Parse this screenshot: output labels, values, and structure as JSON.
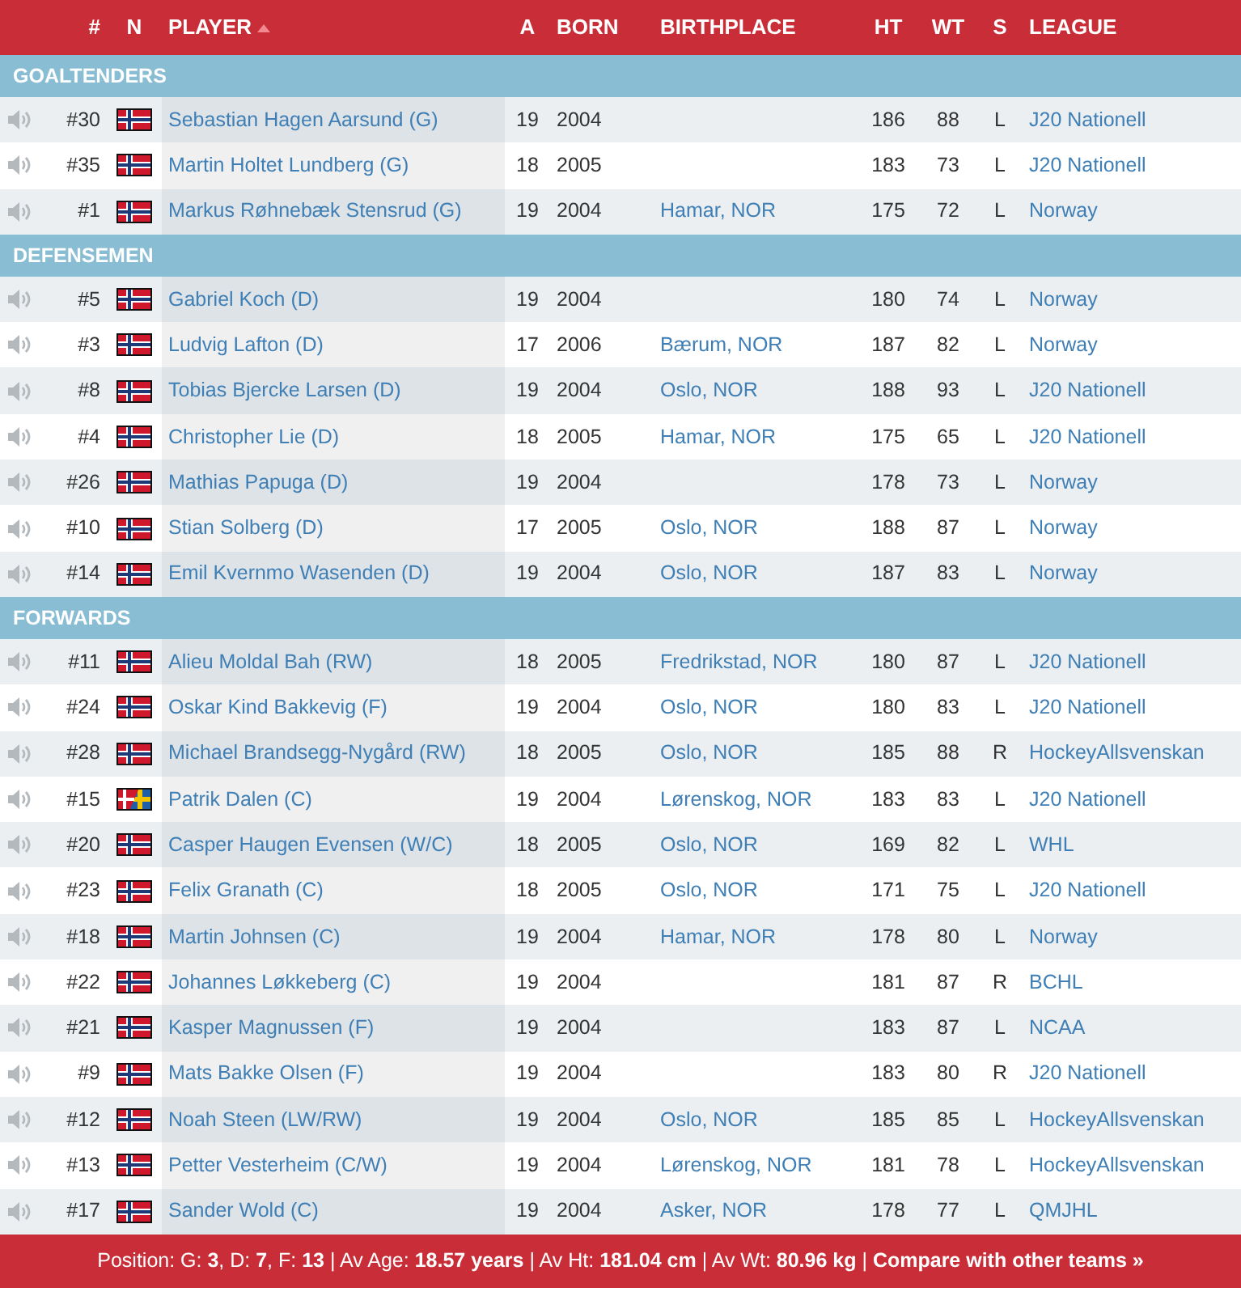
{
  "columns": [
    {
      "sorted": false
    },
    {
      "label": "#",
      "sorted": false
    },
    {
      "label": "N",
      "sorted": false
    },
    {
      "label": "PLAYER",
      "sorted": true
    },
    {
      "label": "A",
      "sorted": false
    },
    {
      "label": "BORN",
      "sorted": false
    },
    {
      "label": "BIRTHPLACE",
      "sorted": false
    },
    {
      "label": "HT",
      "sorted": false
    },
    {
      "label": "WT",
      "sorted": false
    },
    {
      "label": "S",
      "sorted": false
    },
    {
      "label": "LEAGUE",
      "sorted": false
    }
  ],
  "groups": [
    {
      "title": "GOALTENDERS",
      "players": [
        {
          "number": "#30",
          "dual_nationality": false,
          "name": "Sebastian Hagen Aarsund (G)",
          "age": "19",
          "born": "2004",
          "ht": "186",
          "wt": "88",
          "shoots": "L",
          "league": "J20 Nationell"
        },
        {
          "number": "#35",
          "dual_nationality": false,
          "name": "Martin Holtet Lundberg (G)",
          "age": "18",
          "born": "2005",
          "ht": "183",
          "wt": "73",
          "shoots": "L",
          "league": "J20 Nationell"
        },
        {
          "number": "#1",
          "dual_nationality": false,
          "name": "Markus Røhnebæk Stensrud (G)",
          "age": "19",
          "born": "2004",
          "birthplace": "Hamar, NOR",
          "ht": "175",
          "wt": "72",
          "shoots": "L",
          "league": "Norway"
        }
      ]
    },
    {
      "title": "DEFENSEMEN",
      "players": [
        {
          "number": "#5",
          "dual_nationality": false,
          "name": "Gabriel Koch (D)",
          "age": "19",
          "born": "2004",
          "ht": "180",
          "wt": "74",
          "shoots": "L",
          "league": "Norway"
        },
        {
          "number": "#3",
          "dual_nationality": false,
          "name": "Ludvig Lafton (D)",
          "age": "17",
          "born": "2006",
          "birthplace": "Bærum, NOR",
          "ht": "187",
          "wt": "82",
          "shoots": "L",
          "league": "Norway"
        },
        {
          "number": "#8",
          "dual_nationality": false,
          "name": "Tobias Bjercke Larsen (D)",
          "age": "19",
          "born": "2004",
          "birthplace": "Oslo, NOR",
          "ht": "188",
          "wt": "93",
          "shoots": "L",
          "league": "J20 Nationell"
        },
        {
          "number": "#4",
          "dual_nationality": false,
          "name": "Christopher Lie (D)",
          "age": "18",
          "born": "2005",
          "birthplace": "Hamar, NOR",
          "ht": "175",
          "wt": "65",
          "shoots": "L",
          "league": "J20 Nationell"
        },
        {
          "number": "#26",
          "dual_nationality": false,
          "name": "Mathias Papuga (D)",
          "age": "19",
          "born": "2004",
          "ht": "178",
          "wt": "73",
          "shoots": "L",
          "league": "Norway"
        },
        {
          "number": "#10",
          "dual_nationality": false,
          "name": "Stian Solberg (D)",
          "age": "17",
          "born": "2005",
          "birthplace": "Oslo, NOR",
          "ht": "188",
          "wt": "87",
          "shoots": "L",
          "league": "Norway"
        },
        {
          "number": "#14",
          "dual_nationality": false,
          "name": "Emil Kvernmo Wasenden (D)",
          "age": "19",
          "born": "2004",
          "birthplace": "Oslo, NOR",
          "ht": "187",
          "wt": "83",
          "shoots": "L",
          "league": "Norway"
        }
      ]
    },
    {
      "title": "FORWARDS",
      "players": [
        {
          "number": "#11",
          "dual_nationality": false,
          "name": "Alieu Moldal Bah (RW)",
          "age": "18",
          "born": "2005",
          "birthplace": "Fredrikstad, NOR",
          "ht": "180",
          "wt": "87",
          "shoots": "L",
          "league": "J20 Nationell"
        },
        {
          "number": "#24",
          "dual_nationality": false,
          "name": "Oskar Kind Bakkevig (F)",
          "age": "19",
          "born": "2004",
          "birthplace": "Oslo, NOR",
          "ht": "180",
          "wt": "83",
          "shoots": "L",
          "league": "J20 Nationell"
        },
        {
          "number": "#28",
          "dual_nationality": false,
          "name": "Michael Brandsegg-Nygård (RW)",
          "age": "18",
          "born": "2005",
          "birthplace": "Oslo, NOR",
          "ht": "185",
          "wt": "88",
          "shoots": "R",
          "league": "HockeyAllsvenskan"
        },
        {
          "number": "#15",
          "dual_nationality": true,
          "name": "Patrik Dalen (C)",
          "age": "19",
          "born": "2004",
          "birthplace": "Lørenskog, NOR",
          "ht": "183",
          "wt": "83",
          "shoots": "L",
          "league": "J20 Nationell"
        },
        {
          "number": "#20",
          "dual_nationality": false,
          "name": "Casper Haugen Evensen (W/C)",
          "age": "18",
          "born": "2005",
          "birthplace": "Oslo, NOR",
          "ht": "169",
          "wt": "82",
          "shoots": "L",
          "league": "WHL"
        },
        {
          "number": "#23",
          "dual_nationality": false,
          "name": "Felix Granath (C)",
          "age": "18",
          "born": "2005",
          "birthplace": "Oslo, NOR",
          "ht": "171",
          "wt": "75",
          "shoots": "L",
          "league": "J20 Nationell"
        },
        {
          "number": "#18",
          "dual_nationality": false,
          "name": "Martin Johnsen (C)",
          "age": "19",
          "born": "2004",
          "birthplace": "Hamar, NOR",
          "ht": "178",
          "wt": "80",
          "shoots": "L",
          "league": "Norway"
        },
        {
          "number": "#22",
          "dual_nationality": false,
          "name": "Johannes Løkkeberg (C)",
          "age": "19",
          "born": "2004",
          "ht": "181",
          "wt": "87",
          "shoots": "R",
          "league": "BCHL"
        },
        {
          "number": "#21",
          "dual_nationality": false,
          "name": "Kasper Magnussen (F)",
          "age": "19",
          "born": "2004",
          "ht": "183",
          "wt": "87",
          "shoots": "L",
          "league": "NCAA"
        },
        {
          "number": "#9",
          "dual_nationality": false,
          "name": "Mats Bakke Olsen (F)",
          "age": "19",
          "born": "2004",
          "ht": "183",
          "wt": "80",
          "shoots": "R",
          "league": "J20 Nationell"
        },
        {
          "number": "#12",
          "dual_nationality": false,
          "name": "Noah Steen (LW/RW)",
          "age": "19",
          "born": "2004",
          "birthplace": "Oslo, NOR",
          "ht": "185",
          "wt": "85",
          "shoots": "L",
          "league": "HockeyAllsvenskan"
        },
        {
          "number": "#13",
          "dual_nationality": false,
          "name": "Petter Vesterheim (C/W)",
          "age": "19",
          "born": "2004",
          "birthplace": "Lørenskog, NOR",
          "ht": "181",
          "wt": "78",
          "shoots": "L",
          "league": "HockeyAllsvenskan"
        },
        {
          "number": "#17",
          "dual_nationality": false,
          "name": "Sander Wold (C)",
          "age": "19",
          "born": "2004",
          "birthplace": "Asker, NOR",
          "ht": "178",
          "wt": "77",
          "shoots": "L",
          "league": "QMJHL"
        }
      ]
    }
  ],
  "footer": {
    "summary": "Position: G: **3**, D: **7**, F: **13** | Av Age: **18.57 years** | Av Ht: **181.04 cm** | Av Wt: **80.96 kg** | ",
    "link": "Compare with other teams »"
  }
}
